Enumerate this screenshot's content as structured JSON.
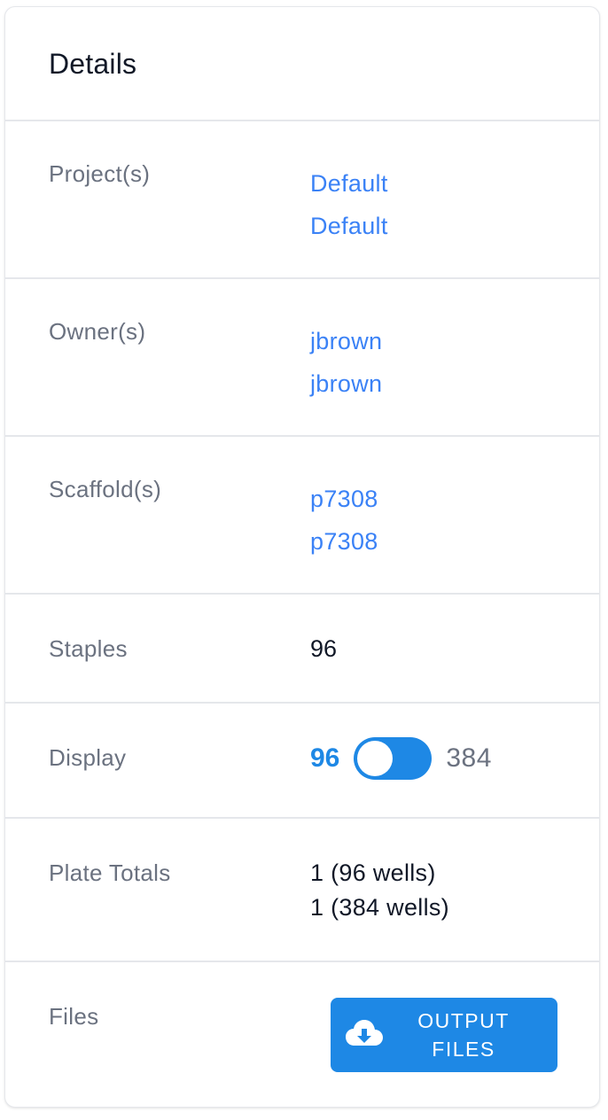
{
  "card": {
    "title": "Details",
    "rows": {
      "projects": {
        "label": "Project(s)",
        "values": [
          "Default",
          "Default"
        ]
      },
      "owners": {
        "label": "Owner(s)",
        "values": [
          "jbrown",
          "jbrown"
        ]
      },
      "scaffolds": {
        "label": "Scaffold(s)",
        "values": [
          "p7308",
          "p7308"
        ]
      },
      "staples": {
        "label": "Staples",
        "value": "96"
      },
      "display": {
        "label": "Display",
        "option_left": "96",
        "option_right": "384",
        "selected": "96"
      },
      "plate_totals": {
        "label": "Plate Totals",
        "values": [
          "1 (96 wells)",
          "1 (384 wells)"
        ]
      },
      "files": {
        "label": "Files",
        "button_line1": "OUTPUT",
        "button_line2": "FILES",
        "button_icon": "cloud-download-icon"
      }
    }
  },
  "colors": {
    "accent": "#1e88e5",
    "link": "#3b82f6",
    "label": "#6b7280",
    "border": "#e5e7eb"
  }
}
